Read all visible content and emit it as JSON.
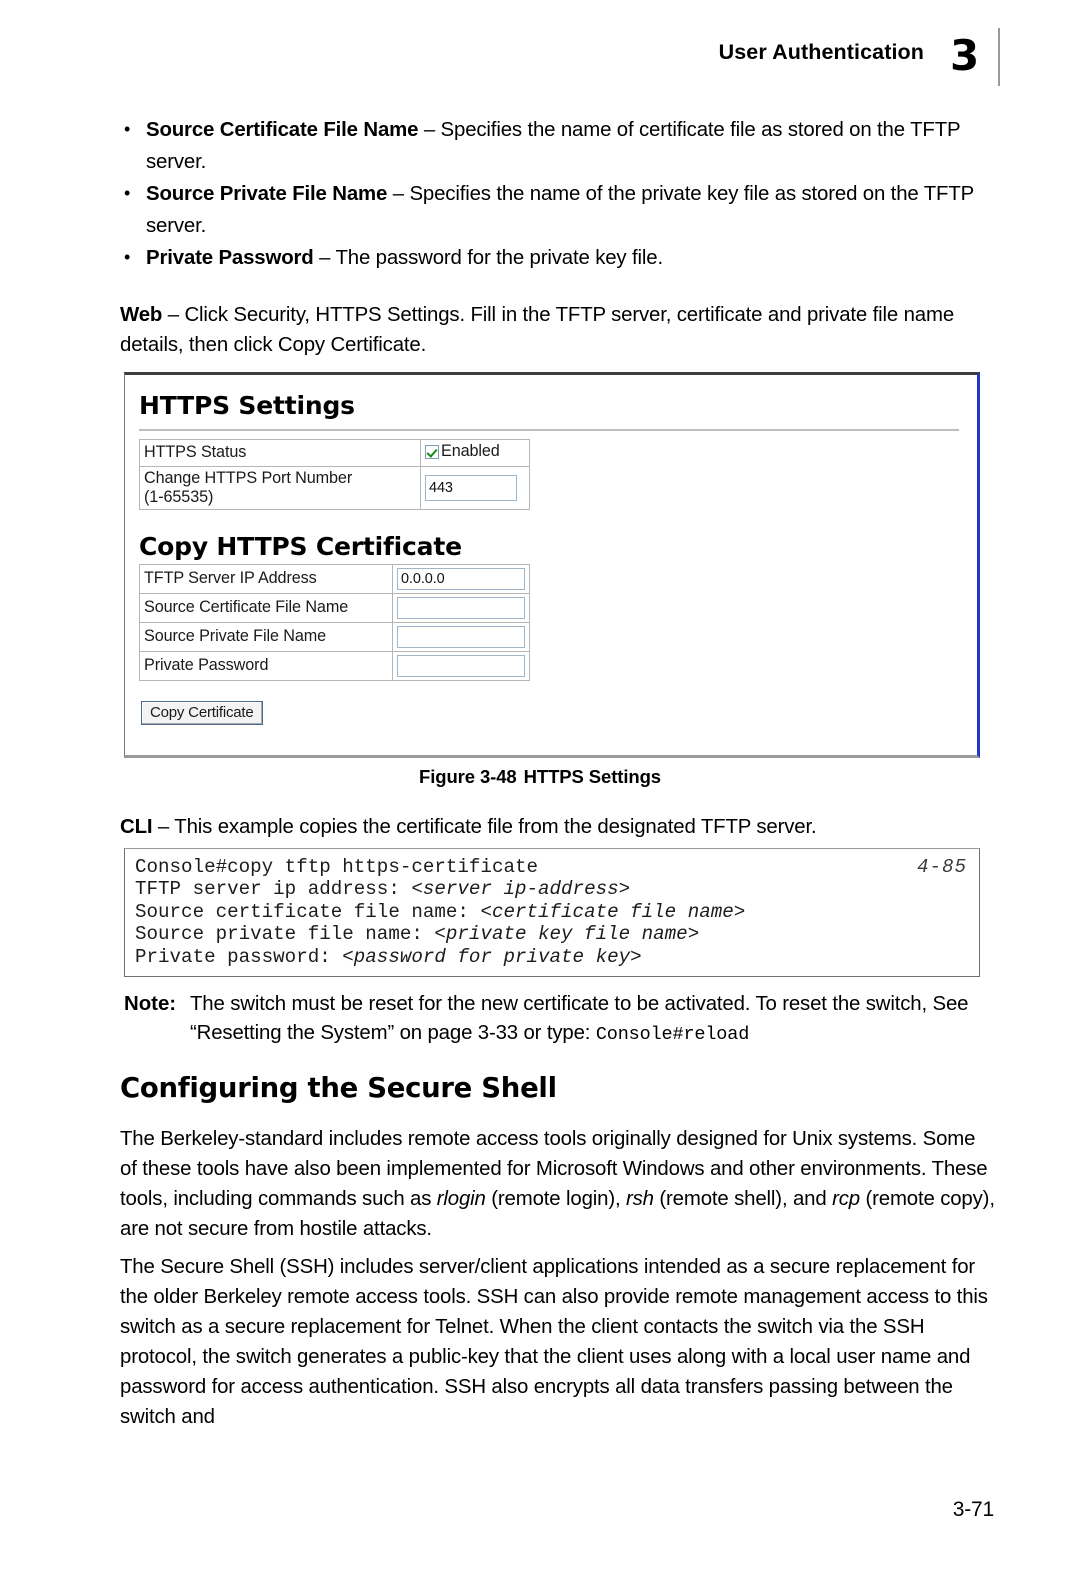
{
  "header": {
    "title": "User Authentication",
    "chapter": "3"
  },
  "bullets": [
    {
      "term": "Source Certificate File Name",
      "dash": " – ",
      "text": "Specifies the name of certificate file as stored on the TFTP server."
    },
    {
      "term": "Source Private File Name",
      "dash": " – ",
      "text": "Specifies the name of the private key file as stored on the TFTP server."
    },
    {
      "term": "Private Password",
      "dash": " – ",
      "text": "The password for the private key file."
    }
  ],
  "web_para": {
    "label": "Web",
    "dash": " – ",
    "text": "Click Security, HTTPS Settings. Fill in the TFTP server, certificate and private file name details, then click Copy Certificate."
  },
  "screenshot": {
    "heading": "HTTPS Settings",
    "settings_rows": [
      {
        "label": "HTTPS Status",
        "control": "checkbox",
        "checked_label": "Enabled",
        "checked": true
      },
      {
        "label": "Change HTTPS Port Number\n(1-65535)",
        "control": "textbox",
        "value": "443"
      }
    ],
    "copy_heading": "Copy HTTPS Certificate",
    "copy_rows": [
      {
        "label": "TFTP Server IP Address",
        "value": "0.0.0.0"
      },
      {
        "label": "Source Certificate File Name",
        "value": ""
      },
      {
        "label": "Source Private File Name",
        "value": ""
      },
      {
        "label": "Private Password",
        "value": ""
      }
    ],
    "button_label": "Copy Certificate"
  },
  "figure_caption": {
    "number": "Figure 3-48",
    "title": "HTTPS Settings"
  },
  "cli_intro": {
    "label": "CLI",
    "dash": " – ",
    "text": "This example copies the certificate file from the designated TFTP server."
  },
  "cli": {
    "reference": "4-85",
    "lines": [
      {
        "plain": "Console#copy tftp https-certificate",
        "italic": ""
      },
      {
        "plain": "TFTP server ip address: ",
        "italic": "<server ip-address>"
      },
      {
        "plain": "Source certificate file name: ",
        "italic": "<certificate file name>"
      },
      {
        "plain": "Source private file name: ",
        "italic": "<private key file name>"
      },
      {
        "plain": "Private password: ",
        "italic": "<password for private key>"
      }
    ]
  },
  "note": {
    "label": "Note:",
    "text_a": "The switch must be reset for the new certificate to be activated. To reset the switch, See “Resetting the System” on page 3-33 or type",
    "colon": ": ",
    "mono": "Console#reload"
  },
  "section": {
    "heading": "Configuring the Secure Shell",
    "para1_a": "The Berkeley-standard includes remote access tools originally designed for Unix systems. Some of these tools have also been implemented for Microsoft Windows and other environments. These tools, including commands such as ",
    "para1_i1": "rlogin",
    "para1_b": " (remote login), ",
    "para1_i2": "rsh",
    "para1_c": " (remote shell), and ",
    "para1_i3": "rcp",
    "para1_d": " (remote copy), are not secure from hostile attacks.",
    "para2": "The Secure Shell (SSH) includes server/client applications intended as a secure replacement for the older Berkeley remote access tools. SSH can also provide remote management access to this switch as a secure replacement for Telnet. When the client contacts the switch via the SSH protocol, the switch generates a public-key that the client uses along with a local user name and password for access authentication. SSH also encrypts all data transfers passing between the switch and"
  },
  "footer": {
    "page_number": "3-71"
  }
}
